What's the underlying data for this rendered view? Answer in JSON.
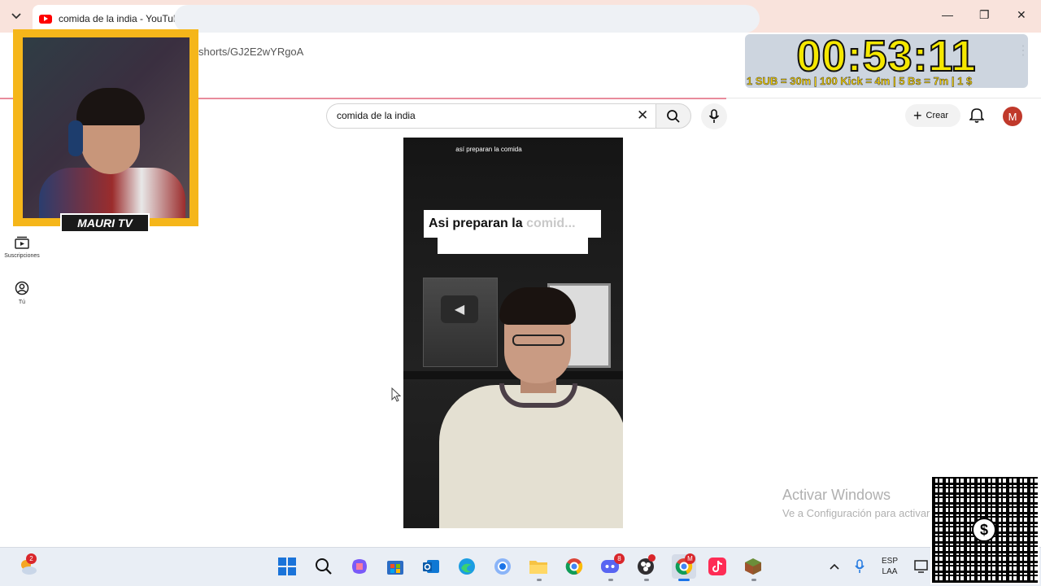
{
  "browser": {
    "tab_title": "comida de la india - YouTube",
    "url": "shorts/GJ2E2wYRgoA"
  },
  "youtube": {
    "search_value": "comida de la india",
    "create_label": "Crear",
    "avatar_letter": "M",
    "sidebar": [
      {
        "label": "Suscripciones",
        "icon": "subscriptions-icon"
      },
      {
        "label": "Tú",
        "icon": "account-icon"
      }
    ]
  },
  "video": {
    "top_caption": "así preparan la comida",
    "caption_main": "Asi preparan la",
    "caption_faded": "comid..."
  },
  "overlay": {
    "streamer_name": "MAURI TV",
    "timer": "00:53:11",
    "timer_rules": "1 SUB = 30m | 100 Kick = 4m | 5 Bs = 7m | 1 $"
  },
  "watermark": {
    "title": "Activar Windows",
    "subtitle": "Ve a Configuración para activar Windows."
  },
  "taskbar": {
    "weather_badge": "2",
    "discord_badge": "8",
    "chrome_badge": "M",
    "lang_line1": "ESP",
    "lang_line2": "LAA"
  },
  "colors": {
    "tab_bar": "#f9e3dc",
    "youtube_red": "#ff0000",
    "overlay_border": "#f5b61a",
    "timer_yellow": "#f5e800"
  }
}
